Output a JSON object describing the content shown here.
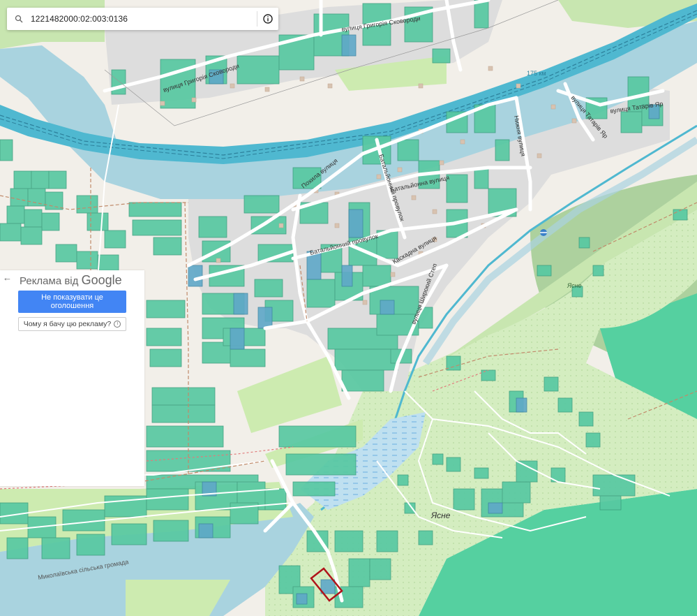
{
  "search": {
    "value": "1221482000:02:003:0136"
  },
  "ad": {
    "title_prefix": "Реклама від",
    "title_brand": "Google",
    "hide_button": "Не показувати це оголошення",
    "why_button": "Чому я бачу цю рекламу?"
  },
  "map": {
    "streets": [
      "вулиця Григорія Сковороди",
      "вулиця Григорія Сковороди",
      "вулиця Татарів Яр",
      "вулиця Татарів Яр",
      "Похила вулиця",
      "Батальйонний провулок",
      "Батальйонна вулиця",
      "Нижня вулиця",
      "Батальйонний провулок",
      "Каскадна вулиця",
      "вулиця Широкий Степ"
    ],
    "places": [
      "Ясне",
      "Ясне"
    ],
    "km_marker": "175 км",
    "area_label": "Миколаївська сільська громада",
    "colors": {
      "background": "#f2efe9",
      "residential": "#dddddd",
      "river": "#a9d3df",
      "canal": "#4fb8d0",
      "parcel": "#58c9a2",
      "parcel_alt": "#5fa8c8",
      "meadow": "#cdebb0",
      "forest": "#add19e",
      "selected_parcel": "#b0131a"
    }
  }
}
